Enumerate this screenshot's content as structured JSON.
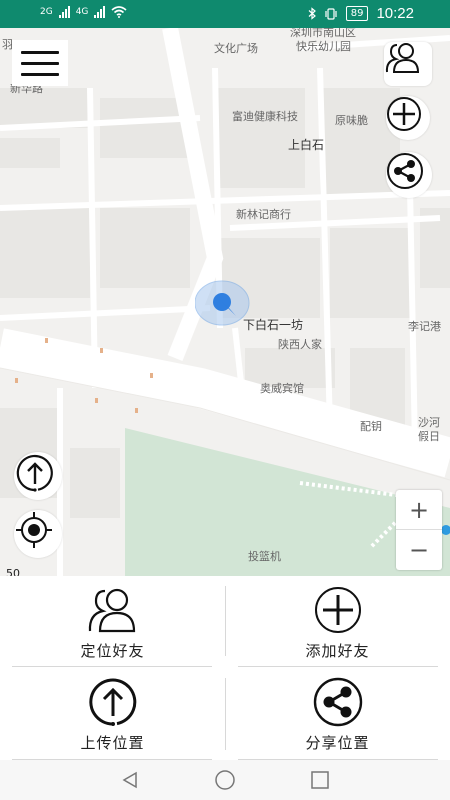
{
  "status_bar": {
    "signal1": "2G",
    "signal2": "4G",
    "battery": "89",
    "time": "10:22"
  },
  "map": {
    "labels": [
      "羽",
      "文化广场",
      "深圳市南山区",
      "快乐幼儿园",
      "新华路",
      "富迪健康科技",
      "原味脆",
      "上白石",
      "新林记商行",
      "下白石一坊",
      "陕西人家",
      "李记港",
      "奥威宾馆",
      "配钥",
      "沙河",
      "假日",
      "投篮机"
    ],
    "scale": "50",
    "zoom_in": "+",
    "zoom_out": "−"
  },
  "actions": {
    "locate_friend": "定位好友",
    "add_friend": "添加好友",
    "upload_location": "上传位置",
    "share_location": "分享位置"
  },
  "colors": {
    "status_bar": "#0f8a6e",
    "map_bg": "#f2f1ef",
    "green_area": "#d2e5d5",
    "location_marker": "#2f7fe0"
  }
}
